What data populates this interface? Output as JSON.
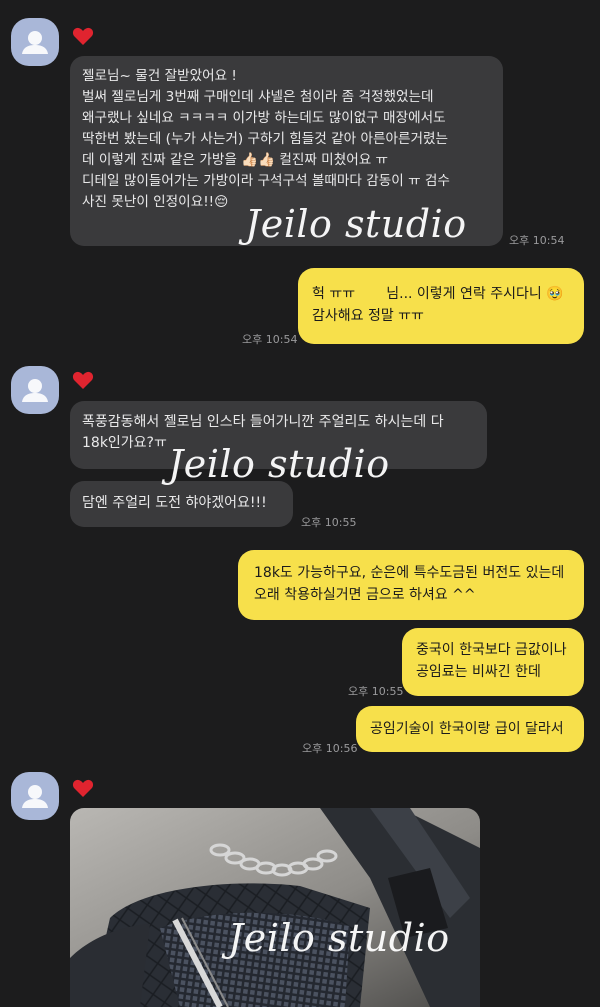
{
  "messages": [
    {
      "id": "m1",
      "text": "젤로님~ 물건 잘받았어요 !\n벌써 젤로님게 3번째 구매인데 샤넬은 첨이라 좀 걱정했었는데\n왜구랬나 싶네요 ㅋㅋㅋㅋ 이가방 하는데도 많이없구 매장에서도\n딱한번 봤는데 (누가 사는거) 구하기 힘들것 같아 아른아른거렸는\n데 이렇게 진짜 같은 가방을 👍🏻👍🏻 컬진짜 미쳤어요 ㅠ\n디테일 많이들어가는 가방이라 구석구석 볼때마다 감동이 ㅠ 검수\n사진 못난이 인정이요!!😔",
      "time": "오후 10:54"
    },
    {
      "id": "m2",
      "text": "헉 ㅠㅠ       님... 이렇게 연락 주시다니 🥹\n감사해요 정말 ㅠㅠ",
      "time": "오후 10:54"
    },
    {
      "id": "m3",
      "text": "폭풍감동해서 젤로님 인스타 들어가니깐 주얼리도 하시는데 다\n18k인가요?ㅠ",
      "time": ""
    },
    {
      "id": "m4",
      "text": "담엔 주얼리 도전 햐야겠어요!!!",
      "time": "오후 10:55"
    },
    {
      "id": "m5",
      "text": "18k도 가능하구요, 순은에 특수도금된 버전도 있는데\n오래 착용하실거면 금으로 하셔요 ^^",
      "time": ""
    },
    {
      "id": "m6",
      "text": "중국이 한국보다 금값이나\n공임료는 비싸긴 한데",
      "time": "오후 10:55"
    },
    {
      "id": "m7",
      "text": "공임기술이 한국이랑 급이 달라서",
      "time": "오후 10:56"
    }
  ],
  "watermark": "Jeilo studio",
  "icons": {
    "avatar": "default-profile-icon",
    "heart": "red-heart-icon"
  },
  "colors": {
    "background": "#1c1c1d",
    "incoming_bubble": "#3a3a3c",
    "outgoing_bubble": "#f7e04b",
    "avatar": "#a9b7d8",
    "heart": "#e0242f"
  }
}
